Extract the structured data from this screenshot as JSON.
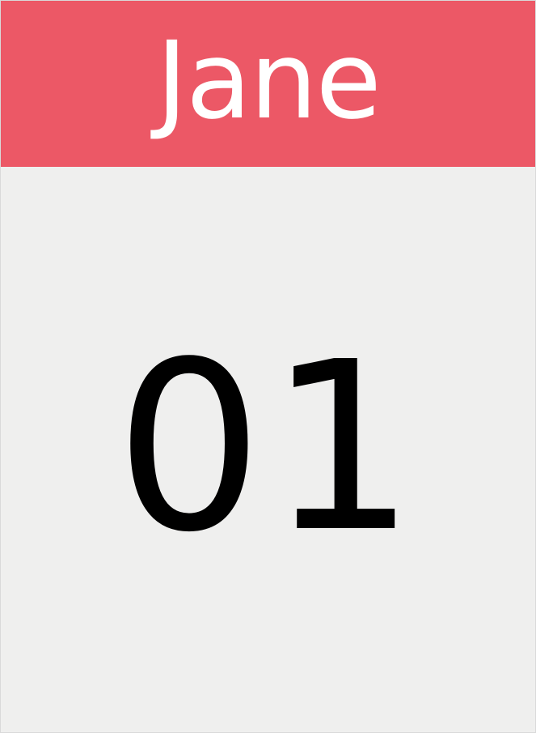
{
  "calendar": {
    "month": "Jane",
    "day": "01"
  },
  "colors": {
    "header_background": "#ec5866",
    "body_background": "#efefee",
    "month_text": "#ffffff",
    "day_text": "#000000"
  }
}
